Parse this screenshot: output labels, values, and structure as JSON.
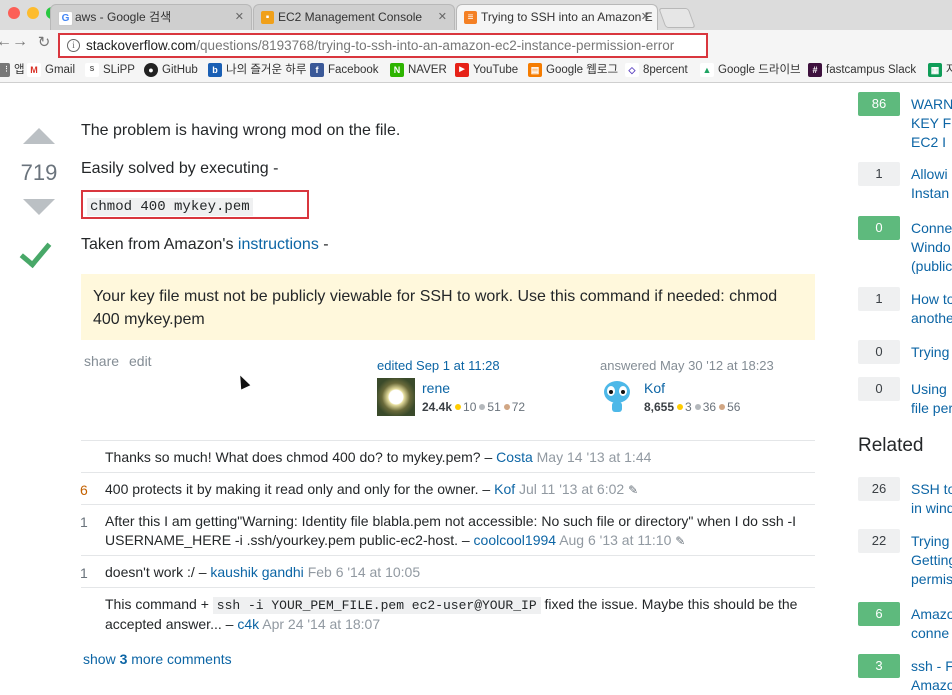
{
  "browser": {
    "tabs": [
      {
        "title": "aws - Google 검색",
        "favicon": "G"
      },
      {
        "title": "EC2 Management Console",
        "favicon": "aws"
      },
      {
        "title": "Trying to SSH into an Amazon E",
        "favicon": "so"
      }
    ],
    "url_host": "stackoverflow.com",
    "url_path": "/questions/8193768/trying-to-ssh-into-an-amazon-ec2-instance-permission-error",
    "bookmarks": [
      {
        "label": "앱",
        "icon": "apps-icon"
      },
      {
        "label": "Gmail",
        "icon": "gmail-icon"
      },
      {
        "label": "SLiPP",
        "icon": "slipp-icon"
      },
      {
        "label": "GitHub",
        "icon": "github-icon"
      },
      {
        "label": "나의 즐거운 하루",
        "icon": "blog-icon"
      },
      {
        "label": "Facebook",
        "icon": "facebook-icon"
      },
      {
        "label": "NAVER",
        "icon": "naver-icon"
      },
      {
        "label": "YouTube",
        "icon": "youtube-icon"
      },
      {
        "label": "Google 웹로그",
        "icon": "analytics-icon"
      },
      {
        "label": "8percent",
        "icon": "8percent-icon"
      },
      {
        "label": "Google 드라이브",
        "icon": "drive-icon"
      },
      {
        "label": "fastcampus Slack",
        "icon": "slack-icon"
      },
      {
        "label": "자",
        "icon": "sheet-icon"
      }
    ]
  },
  "answer": {
    "votes": "719",
    "line1": "The problem is having wrong mod on the file.",
    "line2": "Easily solved by executing -",
    "code": "chmod 400 mykey.pem",
    "taken_prefix": "Taken from Amazon's",
    "taken_link": "instructions",
    "taken_suffix": "-",
    "note": "Your key file must not be publicly viewable for SSH to work. Use this command if needed: chmod 400 mykey.pem",
    "share": "share",
    "edit": "edit",
    "edited": "edited Sep 1 at 11:28",
    "editor": {
      "name": "rene",
      "rep": "24.4k",
      "gold": "10",
      "silver": "51",
      "bronze": "72"
    },
    "answered": "answered May 30 '12 at 18:23",
    "author": {
      "name": "Kof",
      "rep": "8,655",
      "gold": "3",
      "silver": "36",
      "bronze": "56"
    }
  },
  "comments": [
    {
      "score": "",
      "text": "Thanks so much! What does chmod 400 do? to mykey.pem? –",
      "user": "Costa",
      "date": "May 14 '13 at 1:44",
      "edited": false
    },
    {
      "score": "6",
      "text": "400 protects it by making it read only and only for the owner. –",
      "user": "Kof",
      "date": "Jul 11 '13 at 6:02",
      "edited": true
    },
    {
      "score": "1",
      "text": "After this I am getting\"Warning: Identity file blabla.pem not accessible: No such file or directory\" when I do ssh -I USERNAME_HERE -i .ssh/yourkey.pem public-ec2-host. –",
      "user": "coolcool1994",
      "date": "Aug 6 '13 at 11:10",
      "edited": true
    },
    {
      "score": "1",
      "text": "doesn't work :/ –",
      "user": "kaushik gandhi",
      "date": "Feb 6 '14 at 10:05",
      "edited": false
    },
    {
      "score": "",
      "text_before": "This command +",
      "code": "ssh -i YOUR_PEM_FILE.pem ec2-user@YOUR_IP",
      "text_after": "fixed the issue. Maybe this should be the accepted answer... –",
      "user": "c4k",
      "date": "Apr 24 '14 at 18:07",
      "edited": false
    }
  ],
  "more_comments": {
    "prefix": "show",
    "count": "3",
    "suffix": "more comments"
  },
  "sidebar": {
    "linked": [
      {
        "count": "86",
        "answered": true,
        "text": "WARN\nKEY F\nEC2 I"
      },
      {
        "count": "1",
        "answered": false,
        "text": "Allowi\nInstan"
      },
      {
        "count": "0",
        "answered": true,
        "text": "Conne\nWindo\n(public"
      },
      {
        "count": "1",
        "answered": false,
        "text": "How to\nanothe"
      },
      {
        "count": "0",
        "answered": false,
        "text": "Trying"
      },
      {
        "count": "0",
        "answered": false,
        "text": "Using\nfile per"
      }
    ],
    "related_title": "Related",
    "related": [
      {
        "count": "26",
        "answered": false,
        "text": "SSH to\nin wind"
      },
      {
        "count": "22",
        "answered": false,
        "text": "Trying\nGetting\npermis"
      },
      {
        "count": "6",
        "answered": true,
        "text": "Amazo\nconne"
      },
      {
        "count": "3",
        "answered": true,
        "text": "ssh - F\nAmazo"
      }
    ]
  },
  "colors": {
    "accent_red": "#d9363e",
    "link": "#0c65a5",
    "answered_green": "#5eba7d",
    "note_bg": "#fff8dc"
  }
}
